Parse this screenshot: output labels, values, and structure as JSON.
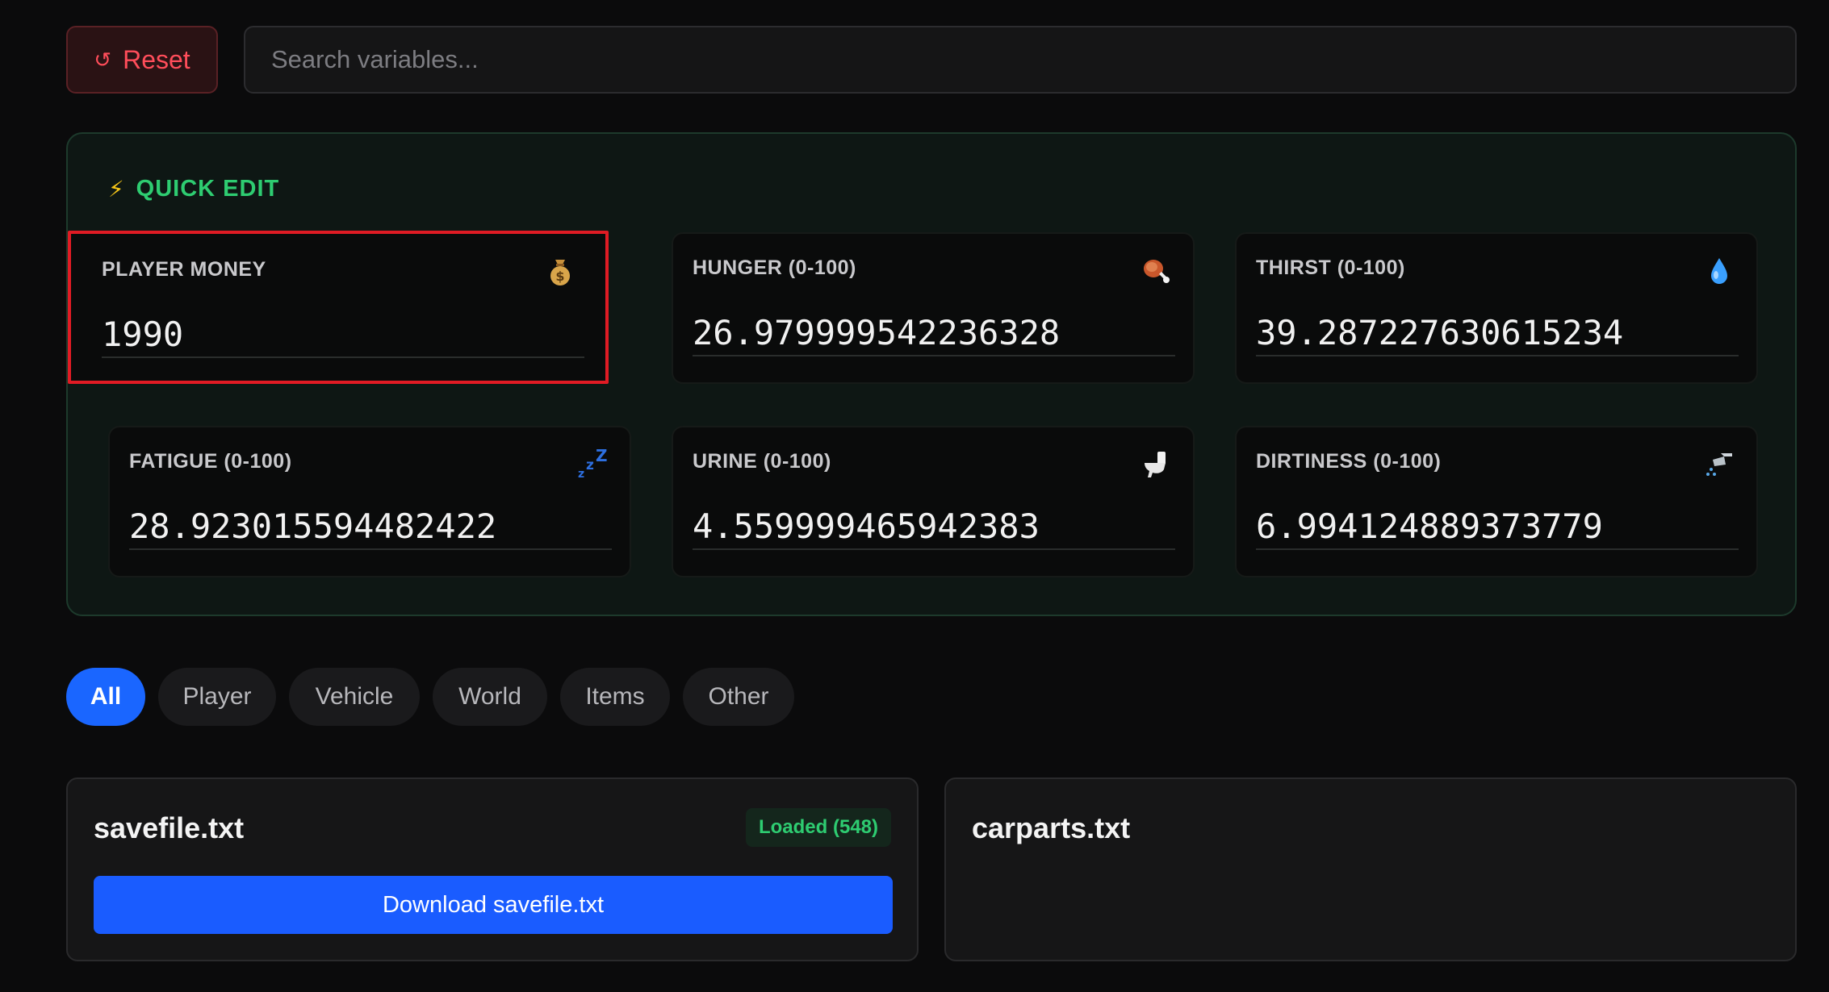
{
  "toolbar": {
    "reset_label": "Reset",
    "reset_icon": "refresh-icon",
    "search_placeholder": "Search variables..."
  },
  "quick_edit": {
    "title": "QUICK EDIT",
    "icon": "lightning-icon",
    "fields": [
      {
        "label": "PLAYER MONEY",
        "value": "1990",
        "icon": "money-bag-icon"
      },
      {
        "label": "HUNGER (0-100)",
        "value": "26.979999542236328",
        "icon": "meat-icon"
      },
      {
        "label": "THIRST (0-100)",
        "value": "39.287227630615234",
        "icon": "droplet-icon"
      },
      {
        "label": "FATIGUE (0-100)",
        "value": "28.923015594482422",
        "icon": "zzz-icon"
      },
      {
        "label": "URINE (0-100)",
        "value": "4.559999465942383",
        "icon": "toilet-icon"
      },
      {
        "label": "DIRTINESS (0-100)",
        "value": "6.994124889373779",
        "icon": "shower-icon"
      }
    ]
  },
  "tabs": [
    {
      "label": "All",
      "active": true
    },
    {
      "label": "Player",
      "active": false
    },
    {
      "label": "Vehicle",
      "active": false
    },
    {
      "label": "World",
      "active": false
    },
    {
      "label": "Items",
      "active": false
    },
    {
      "label": "Other",
      "active": false
    }
  ],
  "files": [
    {
      "name": "savefile.txt",
      "badge": "Loaded (548)",
      "download_label": "Download savefile.txt"
    },
    {
      "name": "carparts.txt"
    }
  ],
  "colors": {
    "accent_blue": "#1a66ff",
    "success_green": "#2ecc71",
    "danger_red": "#ff4d5a",
    "selection_red": "#e01b24"
  }
}
